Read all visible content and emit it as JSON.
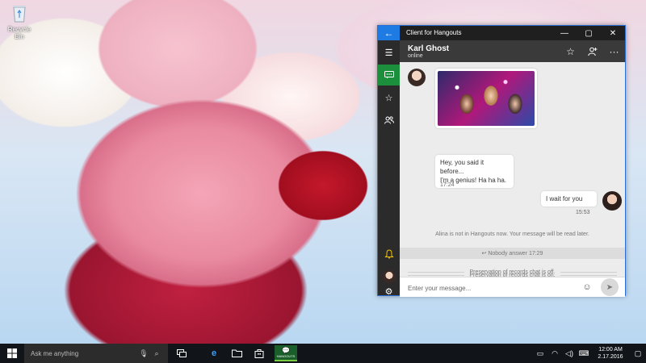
{
  "desktop": {
    "recycle_bin_label": "Recycle Bin"
  },
  "app": {
    "title": "Client for Hangouts",
    "back_icon": "back-arrow-icon",
    "window_controls": {
      "minimize": "—",
      "maximize": "▢",
      "close": "✕"
    },
    "nav": [
      {
        "name": "menu",
        "icon": "hamburger-icon",
        "active": false
      },
      {
        "name": "chats",
        "icon": "chat-icon",
        "active": true
      },
      {
        "name": "favorites",
        "icon": "star-icon",
        "active": false
      },
      {
        "name": "contacts",
        "icon": "people-icon",
        "active": false
      },
      {
        "name": "notifications",
        "icon": "bell-icon",
        "active": false
      },
      {
        "name": "profile",
        "icon": "avatar",
        "active": false
      },
      {
        "name": "settings",
        "icon": "gear-icon",
        "active": false
      }
    ],
    "contact": {
      "name": "Karl Ghost",
      "status": "online"
    },
    "messages": {
      "incoming_text_line1": "Hey, you said it before...",
      "incoming_text_line2": "I'm a genius! Ha ha ha.",
      "incoming_time": "17:24",
      "outgoing_text": "I wait for you",
      "outgoing_time": "15:53"
    },
    "notices": {
      "offline": "Alina is not in Hangouts now. Your message will be read later.",
      "nobody_answer": "Nobody answer",
      "nobody_answer_time": "17:29",
      "preservation_off": "Preservation of records chat is off.",
      "preservation_on": "Preservation of records chat is on."
    },
    "composer": {
      "placeholder": "Enter your message..."
    },
    "colors": {
      "accent_blue": "#1e7be4",
      "active_green": "#1c8f3c",
      "nav_bg": "#2b2b2b",
      "header_bg": "#3a3a3a"
    }
  },
  "taskbar": {
    "search_placeholder": "Ask me anything",
    "hangouts_label": "HANGOUTS",
    "time": "12:00 AM",
    "date": "2.17.2016"
  }
}
